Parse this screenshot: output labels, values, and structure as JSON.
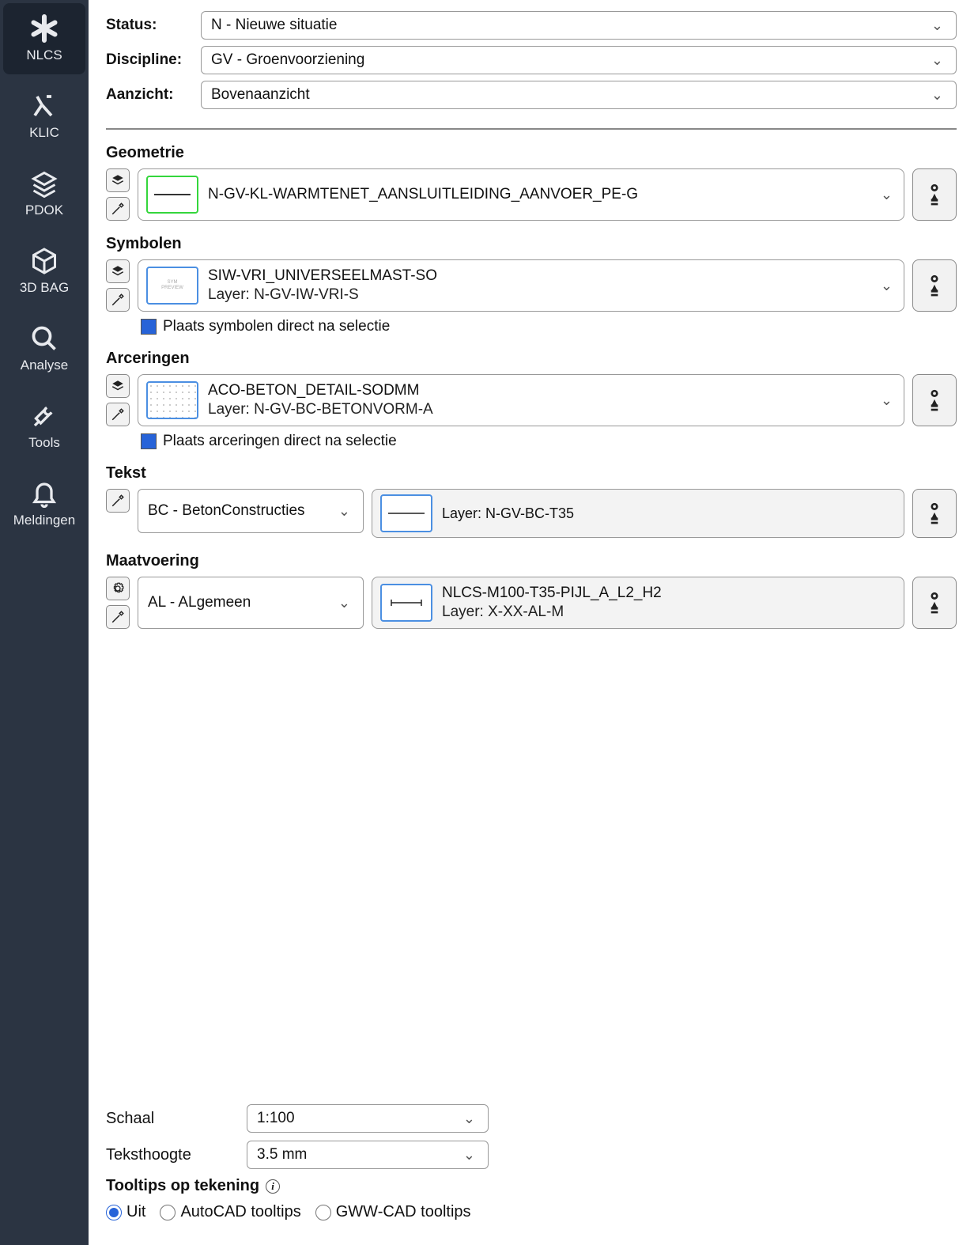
{
  "sidebar": [
    {
      "label": "NLCS"
    },
    {
      "label": "KLIC"
    },
    {
      "label": "PDOK"
    },
    {
      "label": "3D BAG"
    },
    {
      "label": "Analyse"
    },
    {
      "label": "Tools"
    },
    {
      "label": "Meldingen"
    }
  ],
  "top": {
    "status_label": "Status:",
    "status_value": "N - Nieuwe situatie",
    "discipline_label": "Discipline:",
    "discipline_value": "GV - Groenvoorziening",
    "aanzicht_label": "Aanzicht:",
    "aanzicht_value": "Bovenaanzicht"
  },
  "geometrie": {
    "title": "Geometrie",
    "value": "N-GV-KL-WARMTENET_AANSLUITLEIDING_AANVOER_PE-G"
  },
  "symbolen": {
    "title": "Symbolen",
    "line1": "SIW-VRI_UNIVERSEELMAST-SO",
    "line2": "Layer: N-GV-IW-VRI-S",
    "checkbox": "Plaats symbolen direct na selectie"
  },
  "arceringen": {
    "title": "Arceringen",
    "line1": "ACO-BETON_DETAIL-SODMM",
    "line2": "Layer: N-GV-BC-BETONVORM-A",
    "checkbox": "Plaats arceringen direct na selectie"
  },
  "tekst": {
    "title": "Tekst",
    "sel": "BC - BetonConstructies",
    "layer": "Layer: N-GV-BC-T35"
  },
  "maat": {
    "title": "Maatvoering",
    "sel": "AL - ALgemeen",
    "line1": "NLCS-M100-T35-PIJL_A_L2_H2",
    "layer": "Layer: X-XX-AL-M"
  },
  "bottom": {
    "schaal_label": "Schaal",
    "schaal_value": "1:100",
    "teksthoogte_label": "Teksthoogte",
    "teksthoogte_value": "3.5 mm",
    "tooltips_title": "Tooltips op tekening",
    "radio": [
      "Uit",
      "AutoCAD tooltips",
      "GWW-CAD tooltips"
    ]
  }
}
